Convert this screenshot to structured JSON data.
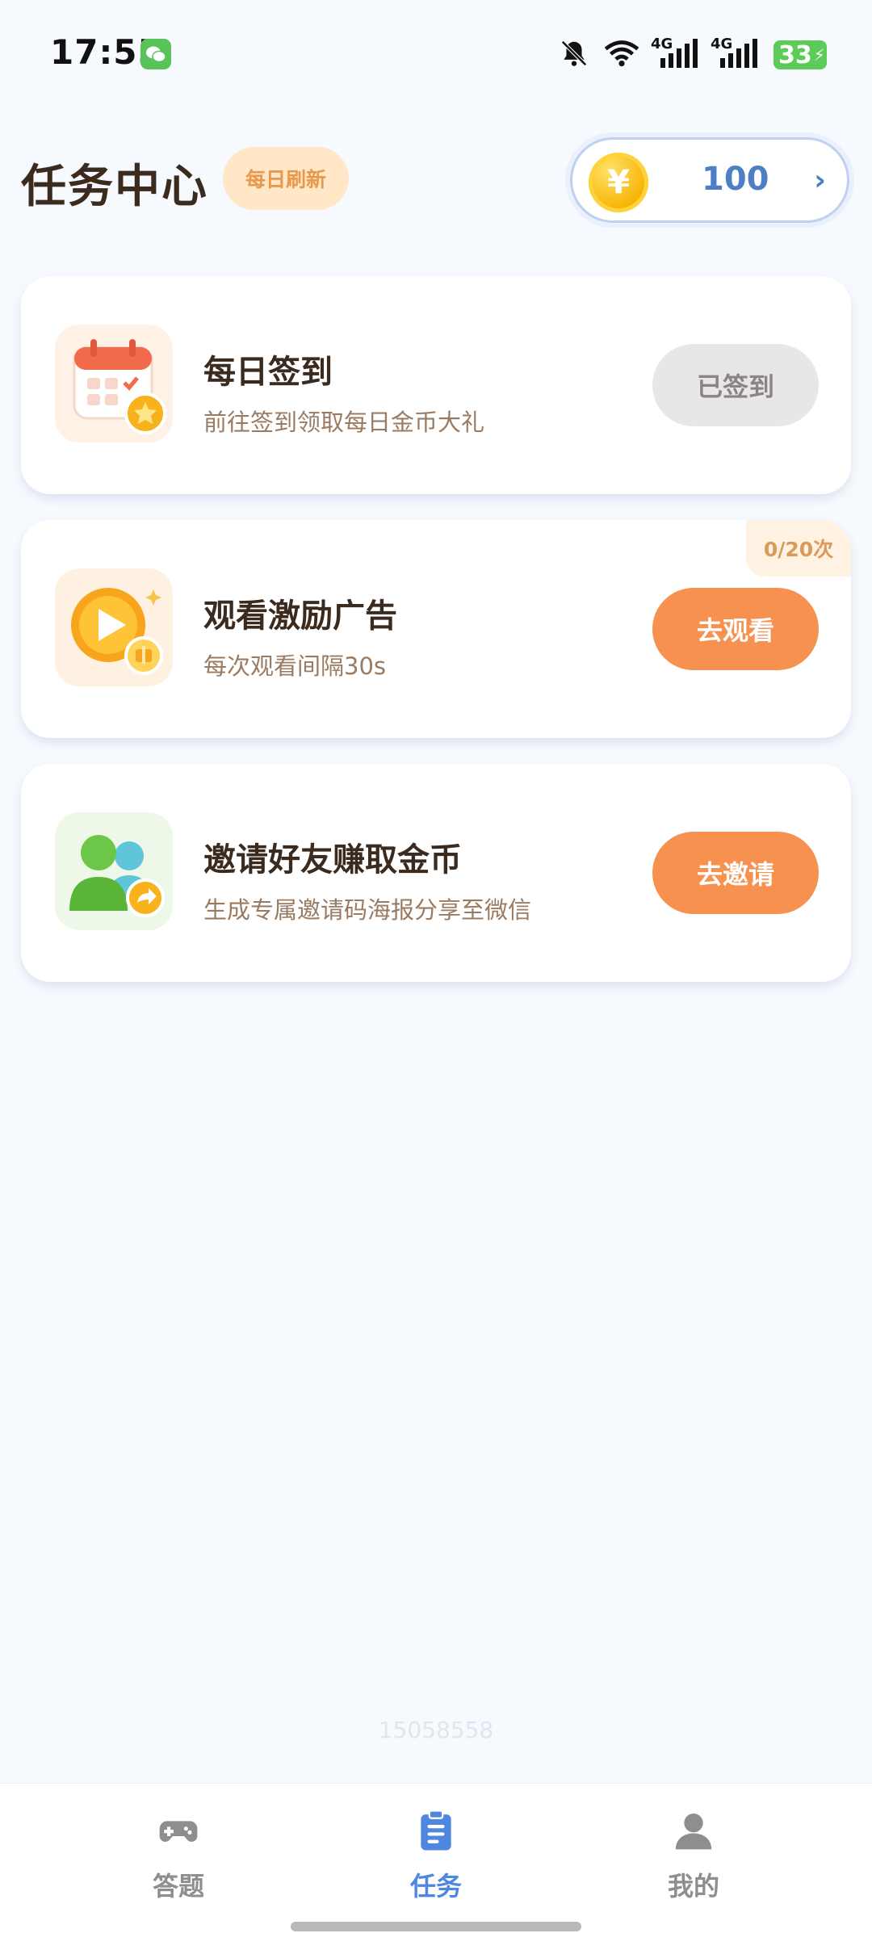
{
  "status_bar": {
    "time": "17:55",
    "net1": "4G",
    "net2": "4G",
    "battery": "33"
  },
  "header": {
    "title": "任务中心",
    "refresh_badge": "每日刷新",
    "coin_value": "100",
    "coin_symbol": "¥"
  },
  "tasks": [
    {
      "title": "每日签到",
      "desc": "前往签到领取每日金币大礼",
      "button": "已签到",
      "icon": "calendar-icon"
    },
    {
      "title": "观看激励广告",
      "desc": "每次观看间隔30s",
      "button": "去观看",
      "progress": "0/20次",
      "icon": "video-play-icon"
    },
    {
      "title": "邀请好友赚取金币",
      "desc": "生成专属邀请码海报分享至微信",
      "button": "去邀请",
      "icon": "invite-friends-icon"
    }
  ],
  "footer_id": "15058558",
  "nav": {
    "items": [
      {
        "label": "答题",
        "icon": "gamepad-icon",
        "active": false
      },
      {
        "label": "任务",
        "icon": "clipboard-icon",
        "active": true
      },
      {
        "label": "我的",
        "icon": "user-icon",
        "active": false
      }
    ]
  },
  "colors": {
    "accent_orange": "#F6914F",
    "accent_blue": "#4F87E0",
    "title_brown": "#3B2A1E",
    "background": "#F6F9FE"
  }
}
